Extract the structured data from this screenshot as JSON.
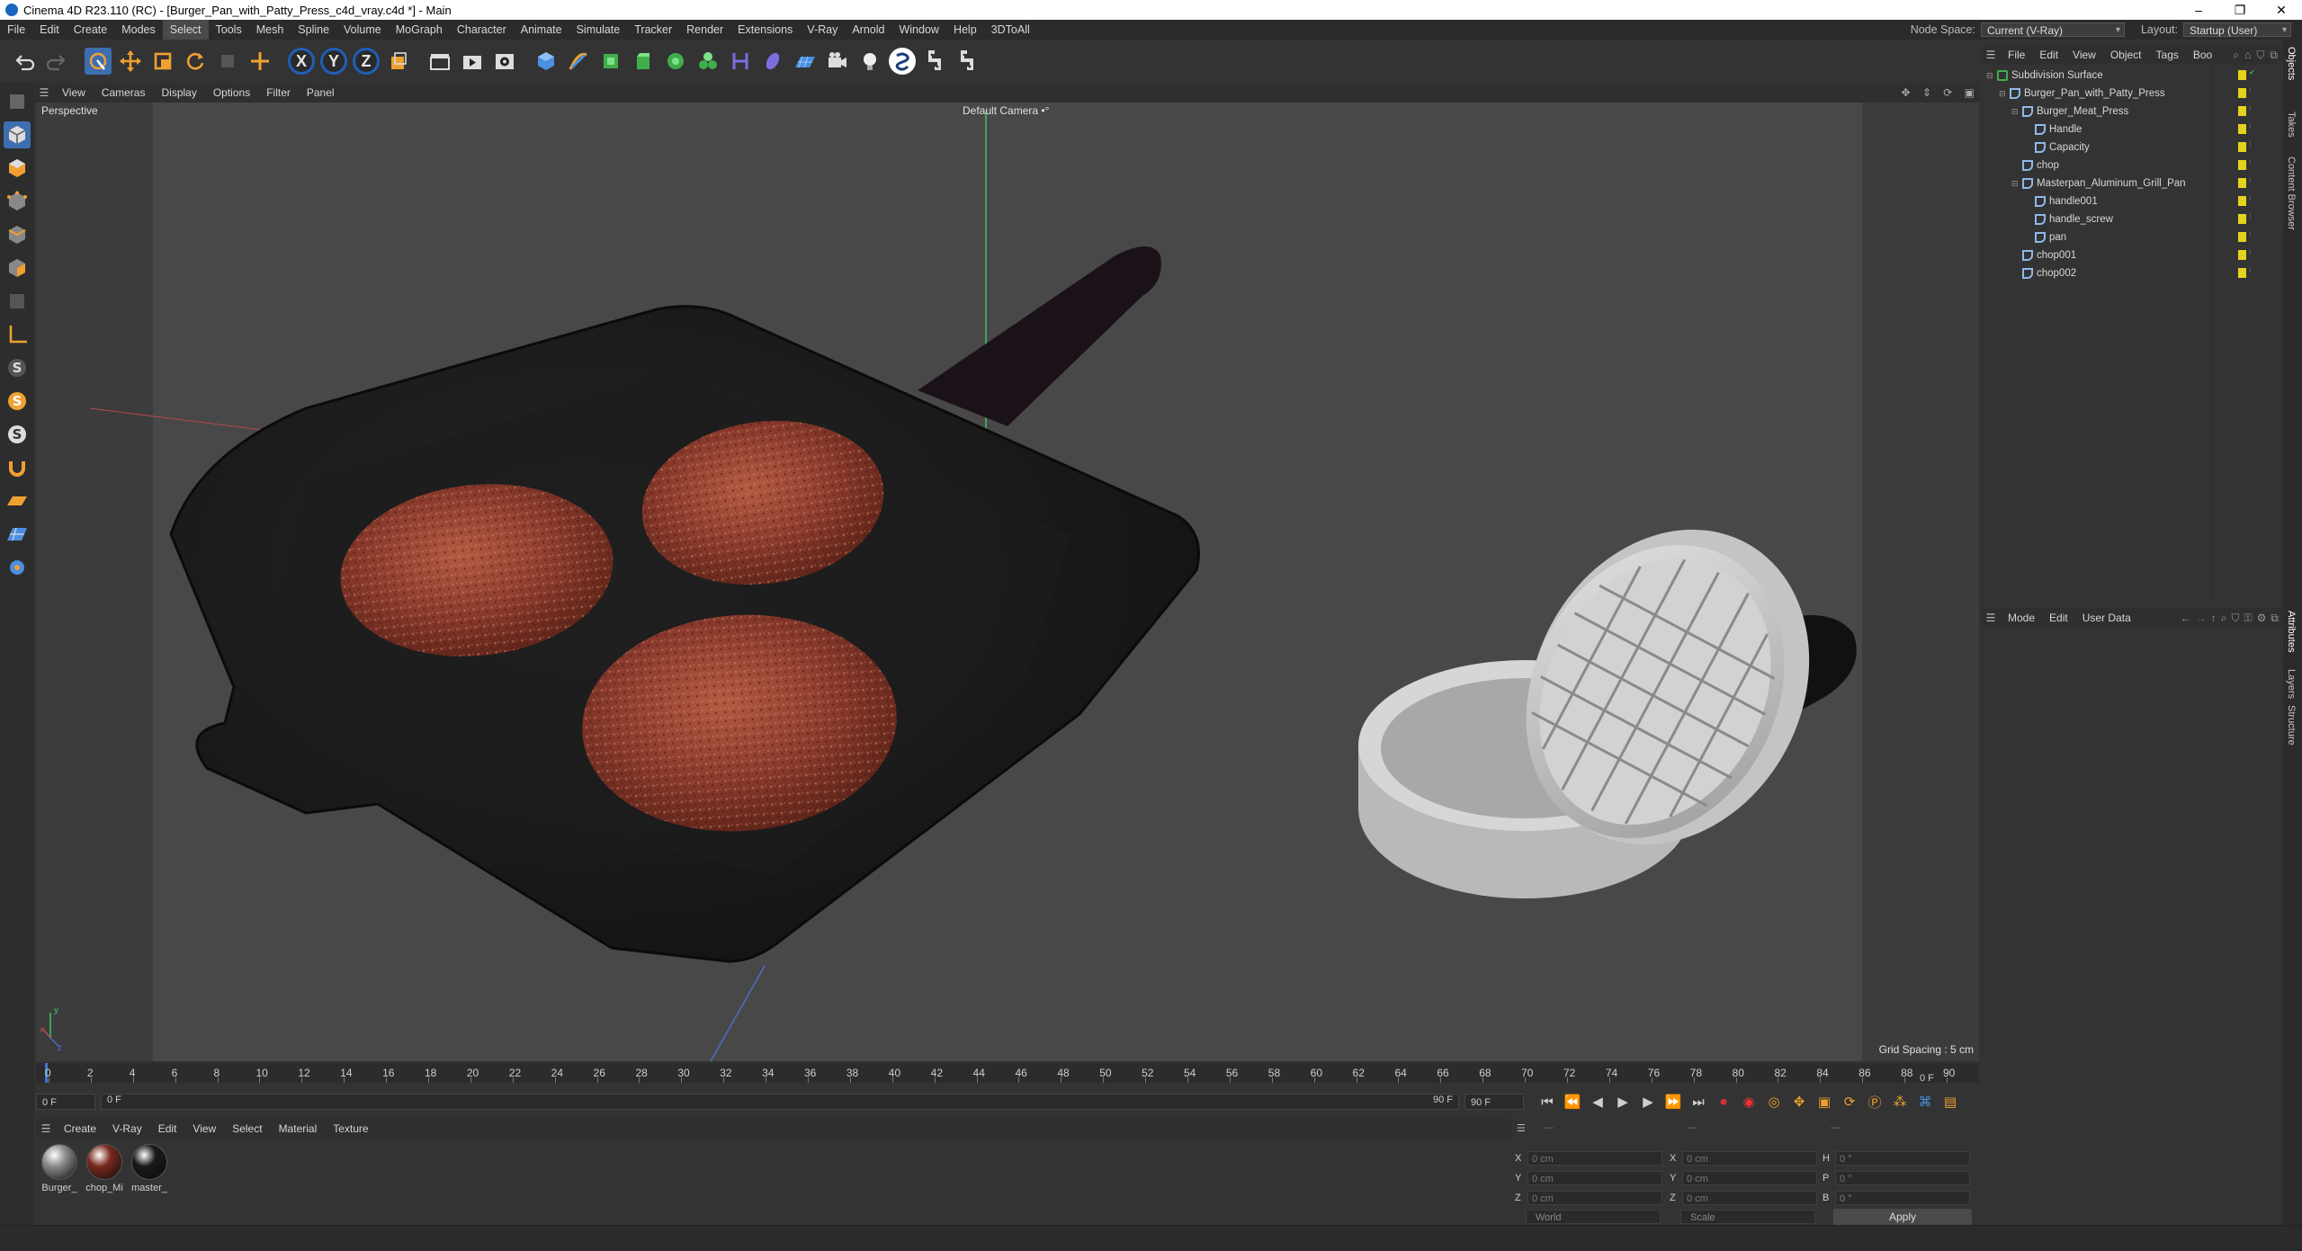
{
  "window": {
    "title": "Cinema 4D R23.110 (RC) - [Burger_Pan_with_Patty_Press_c4d_vray.c4d *] - Main",
    "controls": [
      "–",
      "❐",
      "✕"
    ]
  },
  "menubar": {
    "items": [
      "File",
      "Edit",
      "Create",
      "Modes",
      "Select",
      "Tools",
      "Mesh",
      "Spline",
      "Volume",
      "MoGraph",
      "Character",
      "Animate",
      "Simulate",
      "Tracker",
      "Render",
      "Extensions",
      "V-Ray",
      "Arnold",
      "Window",
      "Help",
      "3DToAll"
    ],
    "active_item": "Select",
    "node_space_label": "Node Space:",
    "node_space_value": "Current (V-Ray)",
    "layout_label": "Layout:",
    "layout_value": "Startup (User)"
  },
  "toolbar": {
    "axis_labels": [
      "X",
      "Y",
      "Z"
    ]
  },
  "viewport": {
    "menu": [
      "View",
      "Cameras",
      "Display",
      "Options",
      "Filter",
      "Panel"
    ],
    "label": "Perspective",
    "camera": "Default Camera",
    "camera_suffix": "•°",
    "grid_spacing": "Grid Spacing : 5 cm",
    "axis_x": "x",
    "axis_y": "y",
    "axis_z": "z"
  },
  "timeline": {
    "ticks": [
      "0",
      "2",
      "4",
      "6",
      "8",
      "10",
      "12",
      "14",
      "16",
      "18",
      "20",
      "22",
      "24",
      "26",
      "28",
      "30",
      "32",
      "34",
      "36",
      "38",
      "40",
      "42",
      "44",
      "46",
      "48",
      "50",
      "52",
      "54",
      "56",
      "58",
      "60",
      "62",
      "64",
      "66",
      "68",
      "70",
      "72",
      "74",
      "76",
      "78",
      "80",
      "82",
      "84",
      "86",
      "88",
      "90"
    ],
    "current_frame_field": "0 F",
    "current_frame_right": "0 F",
    "range_start": "0 F",
    "range_end": "90 F",
    "range_end_field": "90 F"
  },
  "materials": {
    "menu": [
      "Create",
      "V-Ray",
      "Edit",
      "View",
      "Select",
      "Material",
      "Texture"
    ],
    "items": [
      {
        "name": "Burger_",
        "color": "#8c8c8c"
      },
      {
        "name": "chop_Mi",
        "color": "#7a2a1e"
      },
      {
        "name": "master_",
        "color": "#1a1a1a"
      }
    ]
  },
  "coordinates": {
    "header_dashes": "---",
    "x_label": "X",
    "y_label": "Y",
    "z_label": "Z",
    "h_label": "H",
    "p_label": "P",
    "b_label": "B",
    "pos_x": "0 cm",
    "pos_y": "0 cm",
    "pos_z": "0 cm",
    "size_x": "0 cm",
    "size_y": "0 cm",
    "size_z": "0 cm",
    "rot_h": "0 °",
    "rot_p": "0 °",
    "rot_b": "0 °",
    "space": "World",
    "mode": "Scale",
    "apply": "Apply"
  },
  "object_manager": {
    "menu": [
      "File",
      "Edit",
      "View",
      "Object",
      "Tags",
      "Boo"
    ],
    "objects": [
      {
        "name": "Subdivision Surface",
        "depth": 0
      },
      {
        "name": "Burger_Pan_with_Patty_Press",
        "depth": 1
      },
      {
        "name": "Burger_Meat_Press",
        "depth": 2
      },
      {
        "name": "Handle",
        "depth": 3
      },
      {
        "name": "Capacity",
        "depth": 3
      },
      {
        "name": "chop",
        "depth": 2
      },
      {
        "name": "Masterpan_Aluminum_Grill_Pan",
        "depth": 2
      },
      {
        "name": "handle001",
        "depth": 3
      },
      {
        "name": "handle_screw",
        "depth": 3
      },
      {
        "name": "pan",
        "depth": 3
      },
      {
        "name": "chop001",
        "depth": 2
      },
      {
        "name": "chop002",
        "depth": 2
      }
    ]
  },
  "attribute_manager": {
    "menu": [
      "Mode",
      "Edit",
      "User Data"
    ]
  },
  "side_tabs": [
    "Objects",
    "Takes",
    "Content Browser",
    "Attributes",
    "Layers",
    "Structure"
  ],
  "colors": {
    "accent": "#3e79d0",
    "viewport_bg": "#484848",
    "layer_dot": "#e6d21c"
  }
}
